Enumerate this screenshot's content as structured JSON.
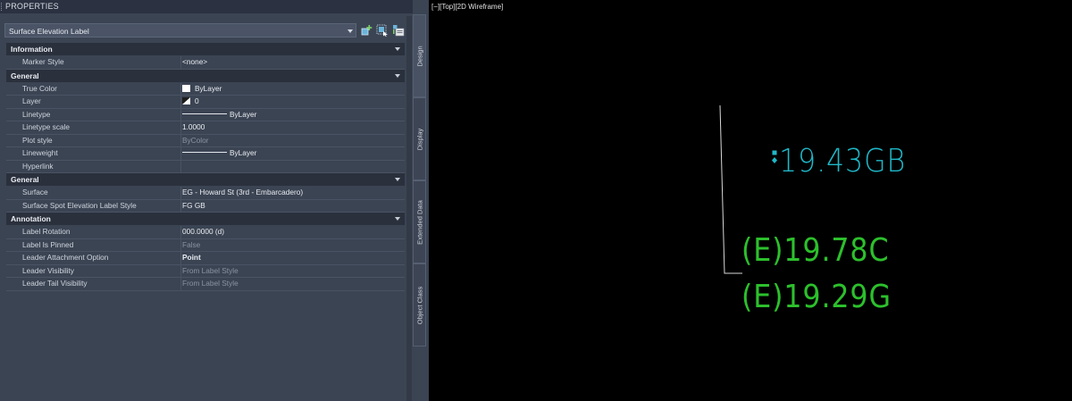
{
  "palette": {
    "title": "PROPERTIES"
  },
  "selector": {
    "value": "Surface Elevation Label"
  },
  "toolbar": {
    "icons": [
      "add-to-selection-icon",
      "select-objects-icon",
      "toggle-pickadd-icon"
    ]
  },
  "sections": [
    {
      "title": "Information",
      "rows": [
        {
          "key": "Marker Style",
          "value": "<none>"
        }
      ]
    },
    {
      "title": "General",
      "rows": [
        {
          "key": "True Color",
          "value": "ByLayer"
        },
        {
          "key": "Layer",
          "value": "0"
        },
        {
          "key": "Linetype",
          "value": "ByLayer"
        },
        {
          "key": "Linetype scale",
          "value": "1.0000"
        },
        {
          "key": "Plot style",
          "value": "ByColor"
        },
        {
          "key": "Lineweight",
          "value": "ByLayer"
        },
        {
          "key": "Hyperlink",
          "value": ""
        }
      ]
    },
    {
      "title": "General",
      "rows": [
        {
          "key": "Surface",
          "value": "EG - Howard St (3rd - Embarcadero)"
        },
        {
          "key": "Surface Spot Elevation Label Style",
          "value": "FG GB"
        }
      ]
    },
    {
      "title": "Annotation",
      "rows": [
        {
          "key": "Label Rotation",
          "value": "000.0000 (d)"
        },
        {
          "key": "Label Is Pinned",
          "value": "False"
        },
        {
          "key": "Leader Attachment Option",
          "value": "Point"
        },
        {
          "key": "Leader Visibility",
          "value": "From Label Style"
        },
        {
          "key": "Leader Tail Visibility",
          "value": "From Label Style"
        }
      ]
    }
  ],
  "tabs": [
    "Design",
    "Display",
    "Extended Data",
    "Object Class"
  ],
  "viewport": {
    "label": "[−][Top][2D Wireframe]",
    "labels": [
      "19.43GB",
      "(E)19.78C",
      "(E)19.29G"
    ],
    "colors": {
      "selected": "#1fb8c8",
      "existing": "#2cc02c",
      "leader": "#d8d8d8"
    }
  }
}
